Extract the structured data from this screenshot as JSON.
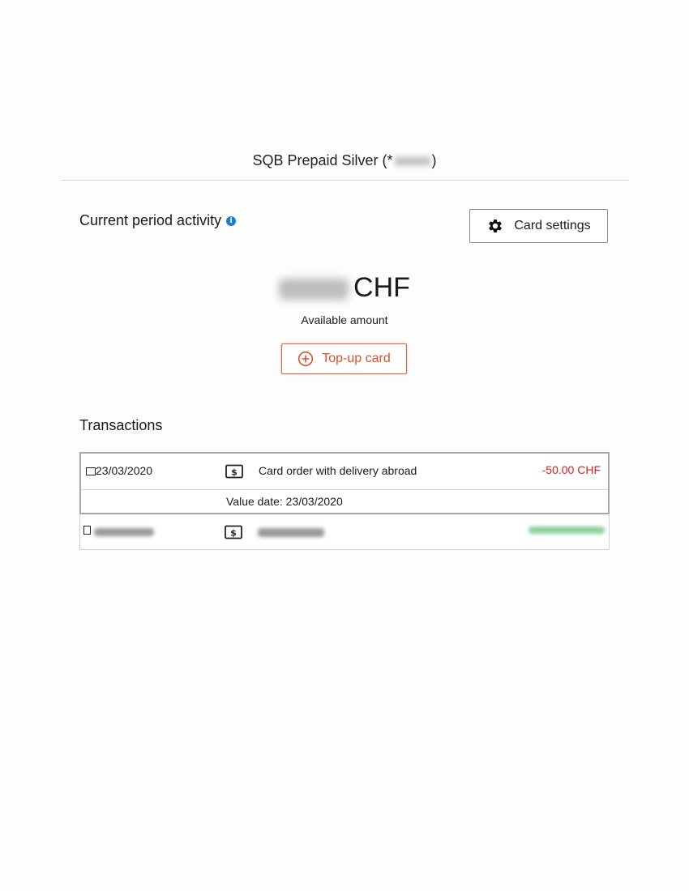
{
  "header": {
    "title_prefix": "SQB Prepaid Silver (*",
    "title_suffix": ")"
  },
  "activity": {
    "heading": "Current period activity",
    "info_icon": "i",
    "settings_button": {
      "label": "Card settings",
      "icon": "gear-icon"
    },
    "currency": "CHF",
    "caption": "Available amount",
    "topup_button": {
      "label": "Top-up card",
      "icon": "plus-circle-icon"
    }
  },
  "transactions": {
    "heading": "Transactions",
    "rows": [
      {
        "date": "23/03/2020",
        "type_icon": "dollar-bill-icon",
        "description": "Card order with delivery abroad",
        "amount": "-50.00 CHF",
        "value_date": "Value date: 23/03/2020"
      }
    ]
  },
  "colors": {
    "accent": "#e8603c",
    "negative_amount": "#d21f1f",
    "info_blue": "#1e7ad6"
  }
}
